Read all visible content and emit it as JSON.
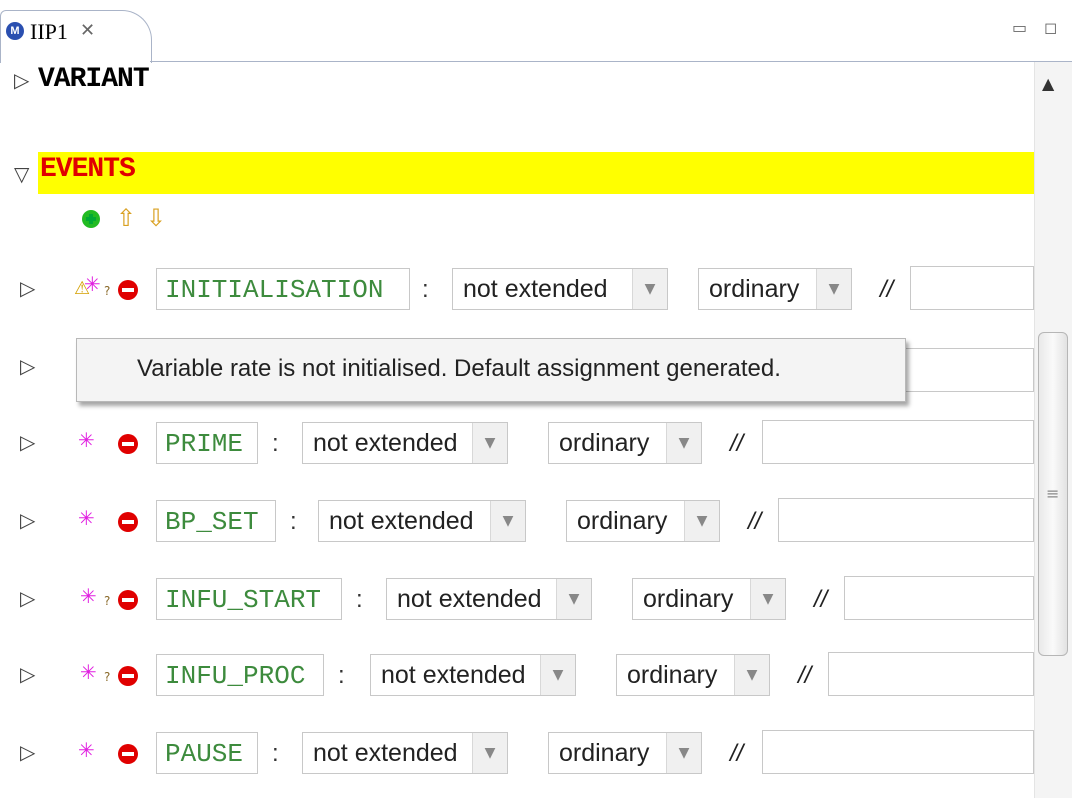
{
  "tab": {
    "icon_letter": "M",
    "title": "IIP1",
    "close": "✕"
  },
  "window_controls": {
    "minimize": "▭",
    "maximize": "◻"
  },
  "sections": {
    "variant": "VARIANT",
    "events": "EVENTS"
  },
  "tooltip": "Variable rate is not initialised. Default assignment generated.",
  "events": [
    {
      "label": "INITIALISATION",
      "extended": "not extended",
      "kind": "ordinary",
      "comment_marker": "//"
    },
    {
      "label": "",
      "extended": "",
      "kind": "",
      "comment_marker": ""
    },
    {
      "label": "PRIME",
      "extended": "not extended",
      "kind": "ordinary",
      "comment_marker": "//"
    },
    {
      "label": "BP_SET",
      "extended": "not extended",
      "kind": "ordinary",
      "comment_marker": "//"
    },
    {
      "label": "INFU_START",
      "extended": "not extended",
      "kind": "ordinary",
      "comment_marker": "//"
    },
    {
      "label": "INFU_PROC",
      "extended": "not extended",
      "kind": "ordinary",
      "comment_marker": "//"
    },
    {
      "label": "PAUSE",
      "extended": "not extended",
      "kind": "ordinary",
      "comment_marker": "//"
    }
  ],
  "colors": {
    "events_highlight": "#ffff00",
    "events_title": "#e00000",
    "event_label": "#3d8b3d"
  },
  "icons": {
    "add": "add-icon",
    "up": "move-up-icon",
    "down": "move-down-icon",
    "star": "wizard-star-icon",
    "remove": "remove-icon",
    "warning": "warning-icon"
  }
}
